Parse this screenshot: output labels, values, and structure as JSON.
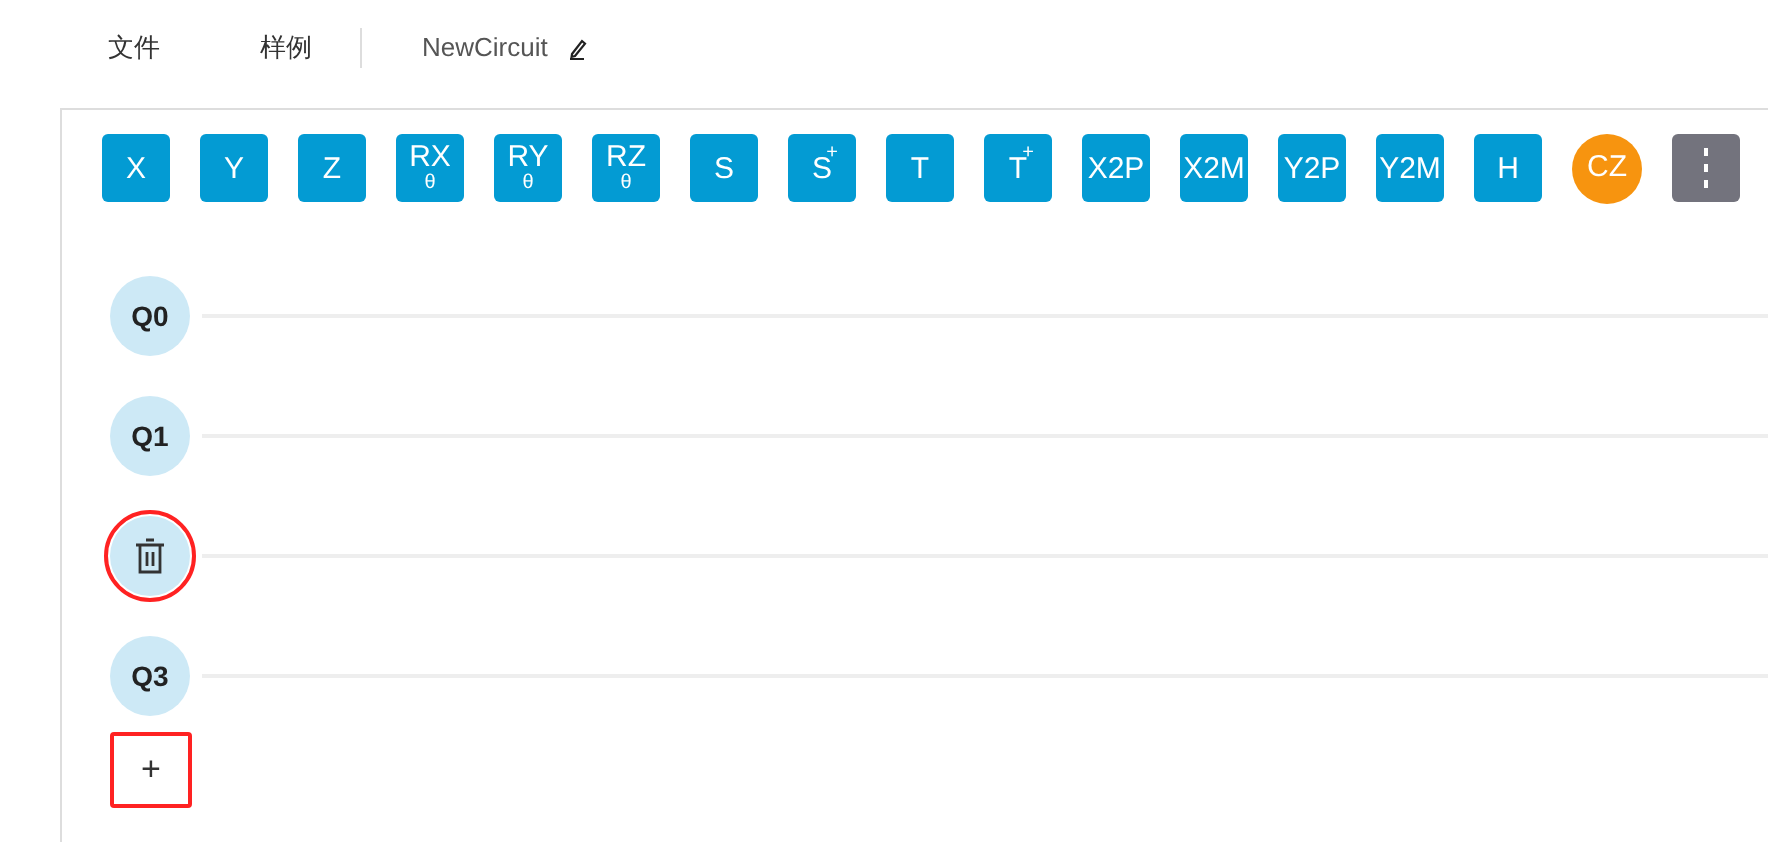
{
  "menu": [
    {
      "label": "文件"
    },
    {
      "label": "样例"
    }
  ],
  "circuit_name": "NewCircuit",
  "gates": [
    {
      "kind": "gate",
      "label": "X"
    },
    {
      "kind": "gate",
      "label": "Y"
    },
    {
      "kind": "gate",
      "label": "Z"
    },
    {
      "kind": "gate",
      "label": "RX",
      "sub": "θ"
    },
    {
      "kind": "gate",
      "label": "RY",
      "sub": "θ"
    },
    {
      "kind": "gate",
      "label": "RZ",
      "sub": "θ"
    },
    {
      "kind": "gate",
      "label": "S"
    },
    {
      "kind": "gate",
      "label": "S",
      "sup": "+"
    },
    {
      "kind": "gate",
      "label": "T"
    },
    {
      "kind": "gate",
      "label": "T",
      "sup": "+"
    },
    {
      "kind": "gate",
      "label": "X2P"
    },
    {
      "kind": "gate",
      "label": "X2M"
    },
    {
      "kind": "gate",
      "label": "Y2P"
    },
    {
      "kind": "gate",
      "label": "Y2M"
    },
    {
      "kind": "gate",
      "label": "H"
    },
    {
      "kind": "cz",
      "label": "CZ"
    },
    {
      "kind": "more"
    }
  ],
  "qubits": [
    {
      "kind": "label",
      "label": "Q0",
      "highlighted": false
    },
    {
      "kind": "label",
      "label": "Q1",
      "highlighted": false
    },
    {
      "kind": "delete",
      "highlighted": true
    },
    {
      "kind": "label",
      "label": "Q3",
      "highlighted": false
    }
  ],
  "add_qubit": {
    "label": "+",
    "highlighted": true
  }
}
